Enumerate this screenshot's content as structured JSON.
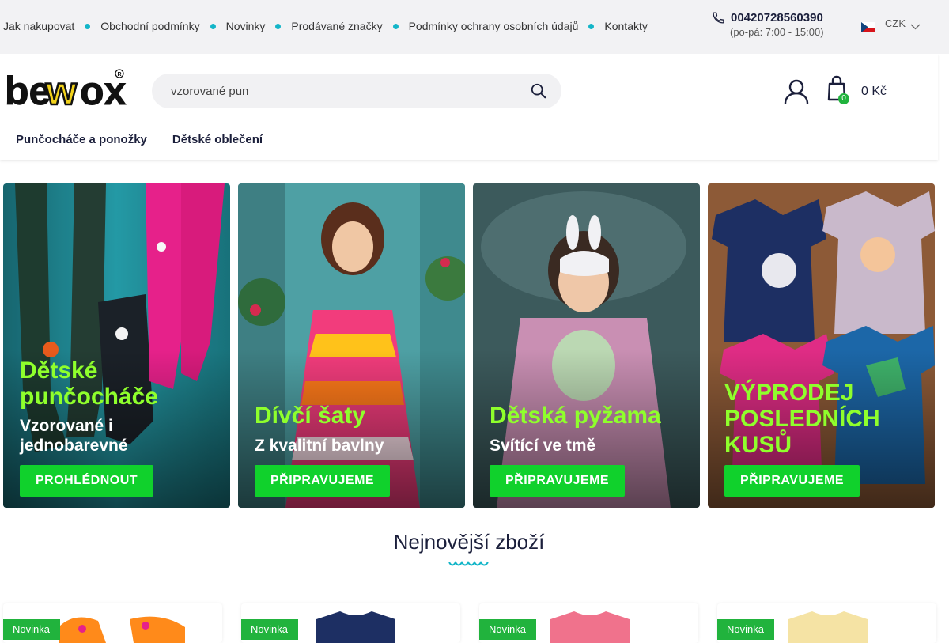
{
  "topbar": {
    "links": [
      "Jak nakupovat",
      "Obchodní podmínky",
      "Novinky",
      "Prodávané značky",
      "Podmínky ochrany osobních údajů",
      "Kontakty"
    ],
    "phone": "00420728560390",
    "hours": "(po-pá: 7:00 - 15:00)",
    "currency": "CZK"
  },
  "header": {
    "logo_text": "bewox",
    "search": {
      "value": "vzorované pun",
      "placeholder": ""
    },
    "cart": {
      "count": "0",
      "total": "0 Kč"
    }
  },
  "nav": {
    "items": [
      "Punčocháče a ponožky",
      "Dětské oblečení"
    ]
  },
  "banners": [
    {
      "title": "Dětské punčocháče",
      "subtitle": "Vzorované i jednobarevné",
      "cta": "PROHLÉDNOUT"
    },
    {
      "title": "Dívčí šaty",
      "subtitle": "Z kvalitní bavlny",
      "cta": "PŘIPRAVUJEME"
    },
    {
      "title": "Dětská pyžama",
      "subtitle": "Svítící ve tmě",
      "cta": "PŘIPRAVUJEME"
    },
    {
      "title": "VÝPRODEJ POSLEDNÍCH KUSŮ",
      "subtitle": "",
      "cta": "PŘIPRAVUJEME"
    }
  ],
  "section": {
    "title": "Nejnovější zboží"
  },
  "products": [
    {
      "badge": "Novinka"
    },
    {
      "badge": "Novinka"
    },
    {
      "badge": "Novinka"
    },
    {
      "badge": "Novinka"
    }
  ],
  "colors": {
    "accent_green": "#10d12c",
    "title_green": "#8fff2c",
    "teal": "#13b5c8",
    "navy": "#1b1f3b"
  },
  "icons": [
    "phone-icon",
    "flag-cz-icon",
    "chevron-down-icon",
    "search-icon",
    "user-icon",
    "cart-icon",
    "wave-icon"
  ]
}
